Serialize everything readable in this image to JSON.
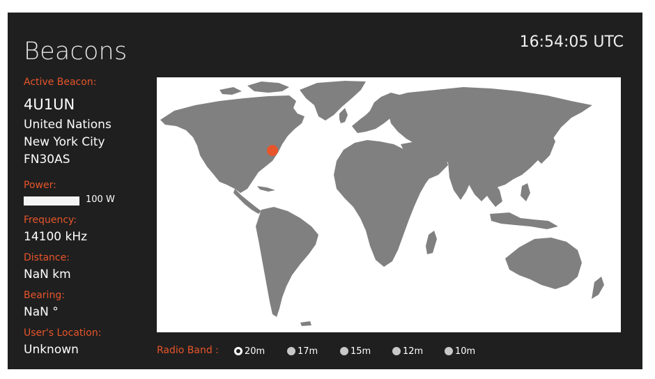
{
  "app": {
    "title": "Beacons"
  },
  "clock": {
    "time": "16:54:05 UTC"
  },
  "beacon": {
    "label": "Active Beacon:",
    "callsign": "4U1UN",
    "name": "United Nations",
    "city": "New York City",
    "grid": "FN30AS"
  },
  "power": {
    "label": "Power:",
    "value": "100 W"
  },
  "frequency": {
    "label": "Frequency:",
    "value": "14100 kHz"
  },
  "distance": {
    "label": "Distance:",
    "value": "NaN km"
  },
  "bearing": {
    "label": "Bearing:",
    "value": "NaN °"
  },
  "user_location": {
    "label": "User's Location:",
    "value": "Unknown"
  },
  "radio_band": {
    "label": "Radio Band :",
    "options": [
      {
        "label": "20m",
        "selected": true
      },
      {
        "label": "17m",
        "selected": false
      },
      {
        "label": "15m",
        "selected": false
      },
      {
        "label": "12m",
        "selected": false
      },
      {
        "label": "10m",
        "selected": false
      }
    ]
  },
  "colors": {
    "background": "#1f1f1f",
    "accent": "#e8552a",
    "land": "#808080",
    "map_background": "#ffffff",
    "marker": "#e8552a"
  }
}
